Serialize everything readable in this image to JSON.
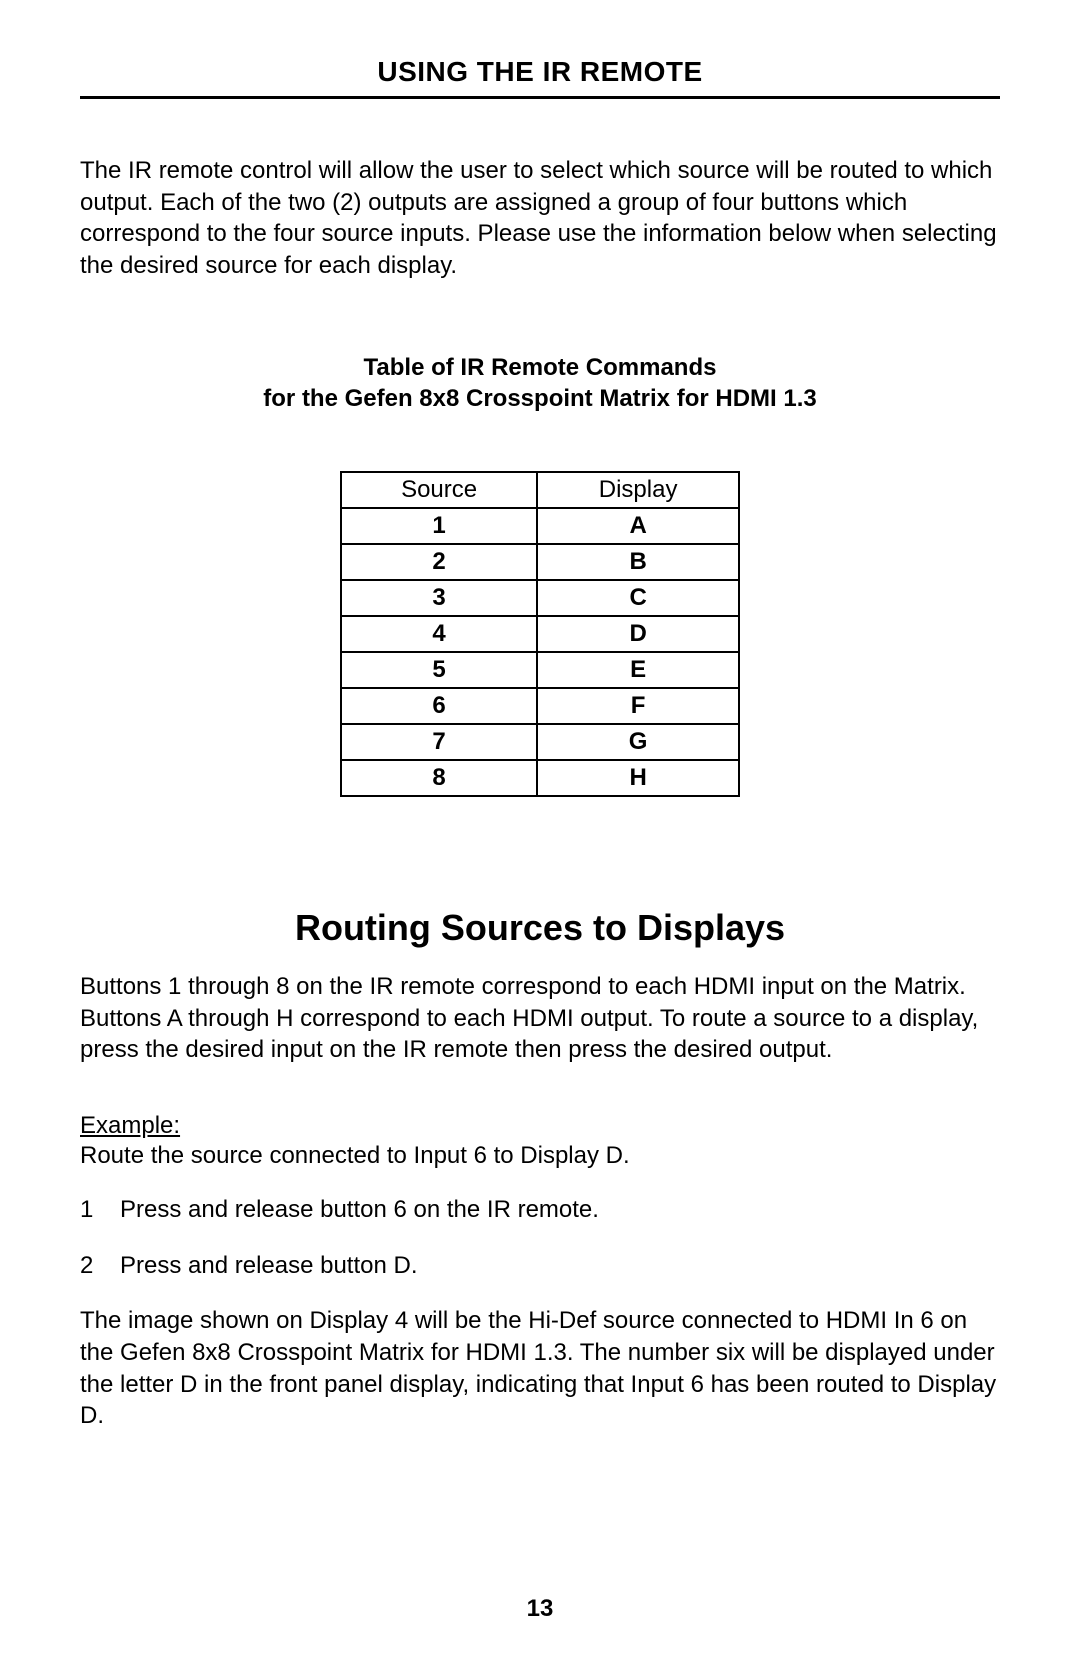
{
  "title": "USING THE IR REMOTE",
  "intro": "The IR remote control will allow the user to select which source will be routed to which output. Each of the two (2) outputs are assigned a group of four buttons which correspond to the four source inputs.  Please use the information below when selecting the desired source for each display.",
  "table_caption_line1": "Table of IR Remote Commands",
  "table_caption_line2": "for the Gefen 8x8 Crosspoint Matrix for HDMI 1.3",
  "table": {
    "headers": {
      "col1": "Source",
      "col2": "Display"
    },
    "rows": [
      {
        "source": "1",
        "display": "A"
      },
      {
        "source": "2",
        "display": "B"
      },
      {
        "source": "3",
        "display": "C"
      },
      {
        "source": "4",
        "display": "D"
      },
      {
        "source": "5",
        "display": "E"
      },
      {
        "source": "6",
        "display": "F"
      },
      {
        "source": "7",
        "display": "G"
      },
      {
        "source": "8",
        "display": "H"
      }
    ]
  },
  "routing_heading": "Routing Sources to Displays",
  "routing_para": "Buttons 1 through 8 on the IR remote correspond to each HDMI input on the Matrix. Buttons A through H correspond to each HDMI output. To route a source to a display, press the desired input on the IR remote then press the desired output.",
  "example_label": "Example:",
  "example_desc": "Route the source connected to Input 6 to Display D.",
  "steps": [
    {
      "num": "1",
      "text": "Press and release button 6 on the IR remote."
    },
    {
      "num": "2",
      "text": "Press and release button D."
    }
  ],
  "closing": "The image shown on Display 4 will be the Hi-Def source connected to HDMI In 6 on the Gefen 8x8 Crosspoint Matrix for HDMI 1.3.  The number six will be displayed under the letter D in the front panel display, indicating that Input 6 has been routed to Display D.",
  "page_number": "13"
}
